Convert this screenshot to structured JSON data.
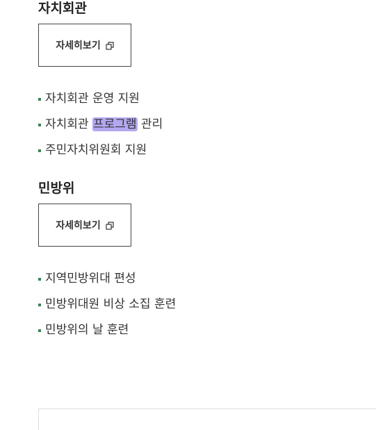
{
  "sections": [
    {
      "title": "자치회관",
      "more_label": "자세히보기",
      "items": [
        {
          "pre": "자치회관 운영 지원",
          "hl": "",
          "post": ""
        },
        {
          "pre": "자치회관 ",
          "hl": "프로그램",
          "post": " 관리"
        },
        {
          "pre": "주민자치위원회 지원",
          "hl": "",
          "post": ""
        }
      ]
    },
    {
      "title": "민방위",
      "more_label": "자세히보기",
      "items": [
        {
          "pre": "지역민방위대 편성",
          "hl": "",
          "post": ""
        },
        {
          "pre": "민방위대원 비상 소집 훈련",
          "hl": "",
          "post": ""
        },
        {
          "pre": "민방위의 날 훈련",
          "hl": "",
          "post": ""
        }
      ]
    }
  ],
  "icons": {
    "external": "new-window-icon",
    "bullet": "square-bullet-icon"
  },
  "colors": {
    "bullet": "#2f8a57",
    "highlight": "#b3a8f0",
    "button_border": "#444444"
  }
}
